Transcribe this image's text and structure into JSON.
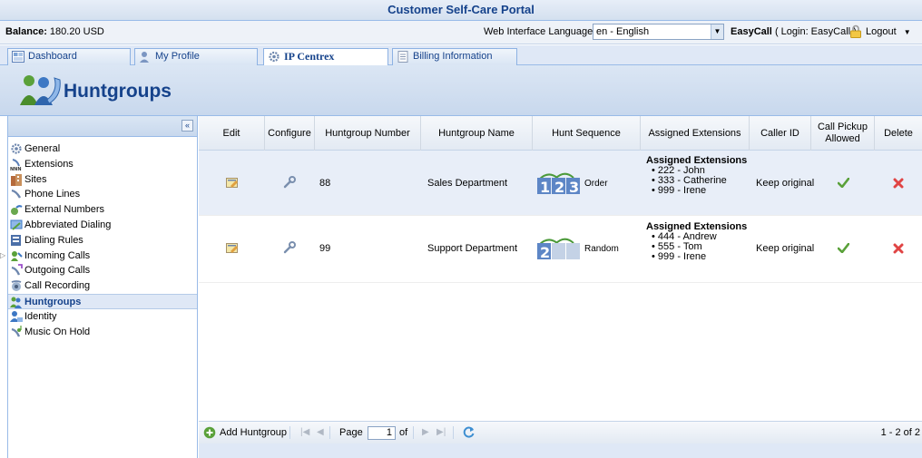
{
  "portal_title": "Customer Self-Care Portal",
  "balance": {
    "label": "Balance:",
    "value": "180.20 USD"
  },
  "language": {
    "label": "Web Interface Language:",
    "selected": "en - English"
  },
  "user": {
    "name": "EasyCall",
    "login_text": "( Login: EasyCall )"
  },
  "logout_label": "Logout",
  "tabs": [
    {
      "label": "Dashboard"
    },
    {
      "label": "My Profile"
    },
    {
      "label": "IP Centrex"
    },
    {
      "label": "Billing Information"
    }
  ],
  "page_title": "Huntgroups",
  "sidebar": {
    "collapse_label": "«",
    "items": [
      {
        "label": "General"
      },
      {
        "label": "Extensions"
      },
      {
        "label": "Sites"
      },
      {
        "label": "Phone Lines"
      },
      {
        "label": "External Numbers"
      },
      {
        "label": "Abbreviated Dialing"
      },
      {
        "label": "Dialing Rules"
      },
      {
        "label": "Incoming Calls"
      },
      {
        "label": "Outgoing Calls"
      },
      {
        "label": "Call Recording"
      },
      {
        "label": "Huntgroups"
      },
      {
        "label": "Identity"
      },
      {
        "label": "Music On Hold"
      }
    ]
  },
  "grid": {
    "columns": [
      "Edit",
      "Configure",
      "Huntgroup Number",
      "Huntgroup Name",
      "Hunt Sequence",
      "Assigned Extensions",
      "Caller ID",
      "Call Pickup Allowed",
      "Delete"
    ],
    "rows": [
      {
        "number": "88",
        "name": "Sales Department",
        "sequence": "Order",
        "sequence_digits": [
          "1",
          "2",
          "3"
        ],
        "extensions_title": "Assigned Extensions",
        "extensions": [
          "222 - John",
          "333 - Catherine",
          "999 - Irene"
        ],
        "caller_id": "Keep original"
      },
      {
        "number": "99",
        "name": "Support Department",
        "sequence": "Random",
        "sequence_digits": [
          "2"
        ],
        "extensions_title": "Assigned Extensions",
        "extensions": [
          "444 - Andrew",
          "555 - Tom",
          "999 - Irene"
        ],
        "caller_id": "Keep original"
      }
    ]
  },
  "footer": {
    "add_label": "Add Huntgroup",
    "page_label": "Page",
    "page_value": "1",
    "of_label": "of",
    "range_label": "1 - 2 of 2"
  },
  "colors": {
    "brand": "#15428b",
    "border": "#99bbe8",
    "row_alt": "#e8eef8"
  }
}
